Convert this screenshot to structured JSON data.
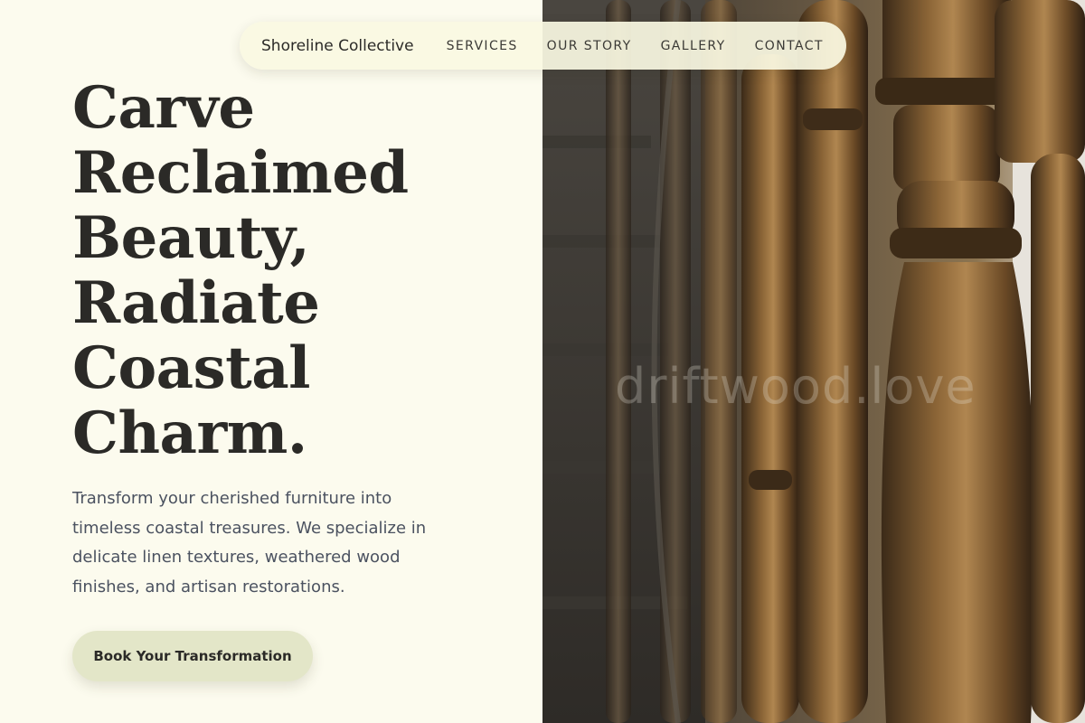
{
  "nav": {
    "brand": "Shoreline Collective",
    "links": [
      "SERVICES",
      "OUR STORY",
      "GALLERY",
      "CONTACT"
    ]
  },
  "hero": {
    "headline_lines": [
      "Carve",
      "Reclaimed",
      "Beauty,",
      "Radiate",
      "Coastal",
      "Charm."
    ],
    "subcopy": "Transform your cherished furniture into timeless coastal treasures. We specialize in delicate linen textures, weathered wood finishes, and artisan restorations.",
    "cta_label": "Book Your Transformation"
  },
  "photo": {
    "subject": "wooden-stair-balusters",
    "watermark": "driftwood.love"
  },
  "colors": {
    "background": "#fcfbee",
    "nav_pill": "#faf8e2",
    "cta": "#e3e6c8",
    "headline": "#2b2a27",
    "body_text": "#4b5260",
    "wood": "#7a5a32"
  }
}
